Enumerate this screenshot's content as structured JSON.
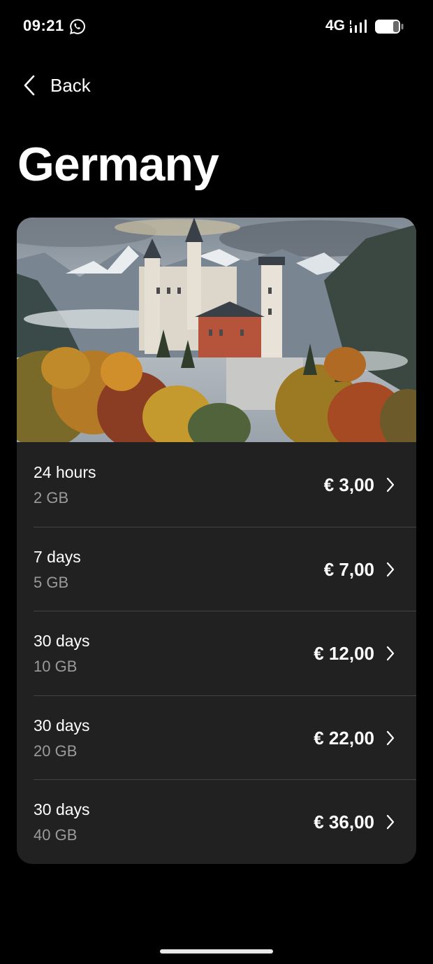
{
  "status_bar": {
    "time": "09:21",
    "network": "4G",
    "icons": [
      "whatsapp-icon",
      "signal-icon",
      "battery-icon"
    ]
  },
  "nav": {
    "back_label": "Back"
  },
  "title": "Germany",
  "hero_image": {
    "subject": "castle-mountains-autumn"
  },
  "plans": [
    {
      "duration": "24 hours",
      "data": "2 GB",
      "price": "€ 3,00"
    },
    {
      "duration": "7 days",
      "data": "5 GB",
      "price": "€ 7,00"
    },
    {
      "duration": "30 days",
      "data": "10 GB",
      "price": "€ 12,00"
    },
    {
      "duration": "30 days",
      "data": "20 GB",
      "price": "€ 22,00"
    },
    {
      "duration": "30 days",
      "data": "40 GB",
      "price": "€ 36,00"
    }
  ],
  "colors": {
    "background": "#000000",
    "card": "#212121",
    "secondary_text": "#9a9a9a",
    "divider": "#444444"
  }
}
